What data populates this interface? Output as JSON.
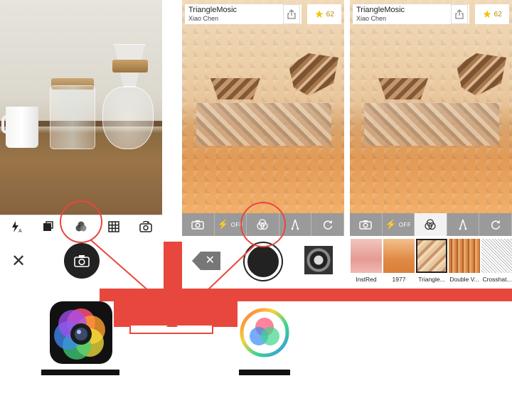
{
  "camera_screen": {
    "toolbar": [
      "flash-auto",
      "crop",
      "filter",
      "grid",
      "switch-camera"
    ]
  },
  "filter_screen": {
    "photo_title": "TriangleMosic",
    "photo_author": "Xiao  Chen",
    "star_count": "62",
    "flash_label": "OFF"
  },
  "gallery_screen": {
    "photo_title": "TriangleMosic",
    "photo_author": "Xiao  Chen",
    "star_count": "62",
    "flash_label": "OFF",
    "filters": [
      {
        "name": "InstRed"
      },
      {
        "name": "1977"
      },
      {
        "name": "Triangle..."
      },
      {
        "name": "Double V..."
      },
      {
        "name": "Crosshat..."
      }
    ],
    "selected_filter_index": 2
  },
  "colors": {
    "accent_red": "#e8473d",
    "toolbar_grey": "#9a9a9a",
    "star_yellow": "#f5c000"
  }
}
